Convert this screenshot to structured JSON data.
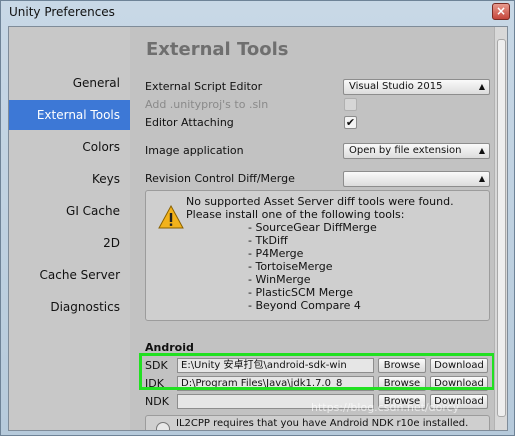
{
  "window": {
    "title": "Unity Preferences",
    "close_glyph": "×"
  },
  "sidebar": {
    "items": [
      {
        "label": "General",
        "selected": false
      },
      {
        "label": "External Tools",
        "selected": true
      },
      {
        "label": "Colors",
        "selected": false
      },
      {
        "label": "Keys",
        "selected": false
      },
      {
        "label": "GI Cache",
        "selected": false
      },
      {
        "label": "2D",
        "selected": false
      },
      {
        "label": "Cache Server",
        "selected": false
      },
      {
        "label": "Diagnostics",
        "selected": false
      }
    ],
    "selected_color": "#3d78d6"
  },
  "main": {
    "heading": "External Tools",
    "external_script_editor": {
      "label": "External Script Editor",
      "value": "Visual Studio 2015"
    },
    "add_unityproj": {
      "label": "Add .unityproj's to .sln",
      "checked": false,
      "enabled": false
    },
    "editor_attaching": {
      "label": "Editor Attaching",
      "checked": true,
      "check_glyph": "✔"
    },
    "image_application": {
      "label": "Image application",
      "value": "Open by file extension"
    },
    "revision_control": {
      "label": "Revision Control Diff/Merge",
      "value": ""
    },
    "diff_help": {
      "line1": "No supported Asset Server diff tools were found.",
      "line2": "Please install one of the following tools:",
      "tools": [
        "- SourceGear DiffMerge",
        "- TkDiff",
        "- P4Merge",
        "- TortoiseMerge",
        "- WinMerge",
        "- PlasticSCM Merge",
        "- Beyond Compare 4"
      ]
    },
    "android": {
      "heading": "Android",
      "sdk": {
        "label": "SDK",
        "path": "E:\\Unity 安卓打包\\android-sdk-win",
        "browse": "Browse",
        "download": "Download"
      },
      "jdk": {
        "label": "JDK",
        "path": "D:\\Program Files\\Java\\jdk1.7.0_8",
        "browse": "Browse",
        "download": "Download"
      },
      "ndk": {
        "label": "NDK",
        "path": "",
        "browse": "Browse",
        "download": "Download"
      },
      "il2cpp_note": "IL2CPP requires that you have Android NDK r10e installed."
    },
    "highlight_color": "#21e021"
  },
  "watermark": "https://blog.csdn.net/dorcy"
}
